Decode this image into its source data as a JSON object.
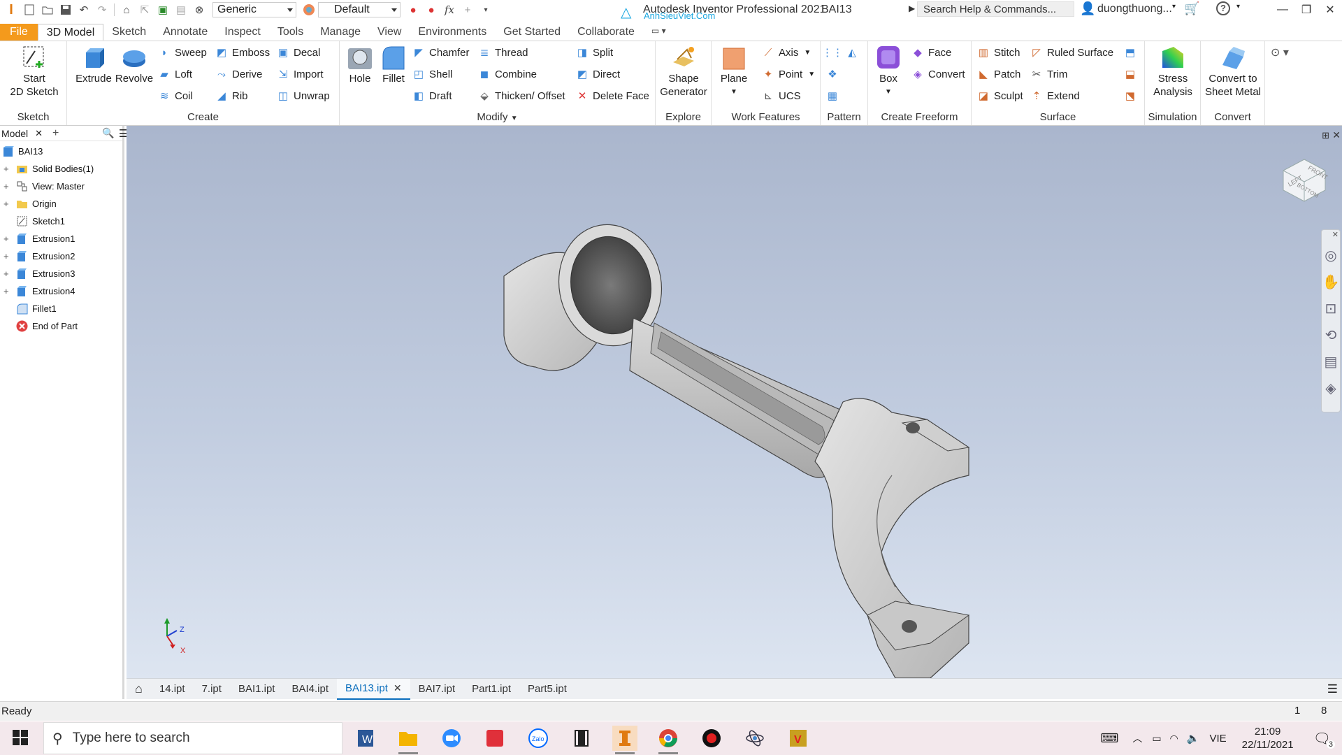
{
  "titlebar": {
    "material": "Generic",
    "appearance": "Default",
    "app_title": "Autodesk Inventor Professional 2021",
    "watermark": "AnhSieuViet.Com",
    "doc_title": "BAI13",
    "help_search": "Search Help & Commands...",
    "user": "duongthuong..."
  },
  "tabs": [
    "File",
    "3D Model",
    "Sketch",
    "Annotate",
    "Inspect",
    "Tools",
    "Manage",
    "View",
    "Environments",
    "Get Started",
    "Collaborate"
  ],
  "ribbon": {
    "sketch": {
      "title": "Sketch",
      "start": "Start",
      "start2": "2D Sketch"
    },
    "create": {
      "title": "Create",
      "extrude": "Extrude",
      "revolve": "Revolve",
      "sweep": "Sweep",
      "emboss": "Emboss",
      "decal": "Decal",
      "loft": "Loft",
      "derive": "Derive",
      "import": "Import",
      "coil": "Coil",
      "rib": "Rib",
      "unwrap": "Unwrap"
    },
    "modify": {
      "title": "Modify",
      "hole": "Hole",
      "fillet": "Fillet",
      "chamfer": "Chamfer",
      "thread": "Thread",
      "split": "Split",
      "shell": "Shell",
      "combine": "Combine",
      "direct": "Direct",
      "draft": "Draft",
      "thicken": "Thicken/ Offset",
      "delete_face": "Delete Face"
    },
    "explore": {
      "title": "Explore",
      "shape": "Shape",
      "generator": "Generator"
    },
    "work": {
      "title": "Work Features",
      "plane": "Plane",
      "axis": "Axis",
      "point": "Point",
      "ucs": "UCS"
    },
    "pattern": {
      "title": "Pattern"
    },
    "freeform": {
      "title": "Create Freeform",
      "box": "Box",
      "face": "Face",
      "convert": "Convert"
    },
    "surface": {
      "title": "Surface",
      "stitch": "Stitch",
      "ruled": "Ruled Surface",
      "patch": "Patch",
      "trim": "Trim",
      "sculpt": "Sculpt",
      "extend": "Extend"
    },
    "simulation": {
      "title": "Simulation",
      "stress": "Stress",
      "analysis": "Analysis"
    },
    "convert": {
      "title": "Convert",
      "c1": "Convert to",
      "c2": "Sheet Metal"
    }
  },
  "browser": {
    "tab": "Model",
    "items": [
      "BAI13",
      "Solid Bodies(1)",
      "View: Master",
      "Origin",
      "Sketch1",
      "Extrusion1",
      "Extrusion2",
      "Extrusion3",
      "Extrusion4",
      "Fillet1",
      "End of Part"
    ]
  },
  "viewcube": {
    "left": "LEFT",
    "front": "FRONT",
    "bottom": "BOTTOM"
  },
  "triad": {
    "z": "Z",
    "x": "X"
  },
  "doc_tabs": [
    "14.ipt",
    "7.ipt",
    "BAI1.ipt",
    "BAI4.ipt",
    "BAI13.ipt",
    "BAI7.ipt",
    "Part1.ipt",
    "Part5.ipt"
  ],
  "status": {
    "text": "Ready",
    "n1": "1",
    "n2": "8"
  },
  "taskbar": {
    "search_placeholder": "Type here to search",
    "lang": "VIE",
    "time": "21:09",
    "date": "22/11/2021",
    "notif_count": "3"
  },
  "colors": {
    "file_tab": "#f49a1c",
    "accent": "#0a6ebd",
    "viewport_top": "#aab6cd",
    "viewport_bottom": "#dde5f1"
  }
}
